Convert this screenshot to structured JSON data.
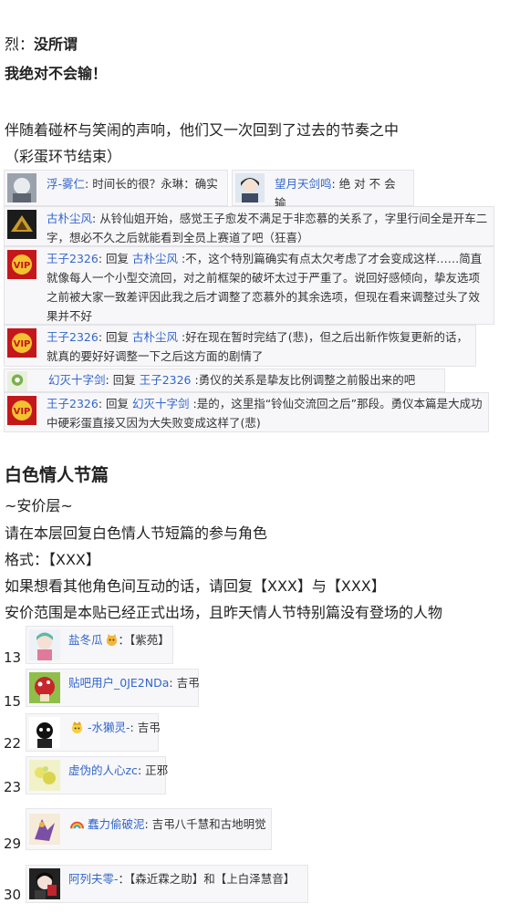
{
  "dialog": {
    "speaker_prefix": "烈：",
    "speaker_line": "没所谓",
    "shout": "我绝对不会输！"
  },
  "narration": "伴随着碰杯与笑闹的声响，他们又一次回到了过去的节奏之中",
  "egg_end": "（彩蛋环节结束）",
  "comments": [
    {
      "user": "浮-雾仁",
      "text": ": 时间长的很？永琳：确实"
    },
    {
      "user": "望月天剑鸣",
      "text": ": 绝 对 不 会 输"
    },
    {
      "user": "古朴尘风",
      "text": ": 从铃仙姐开始，感觉王子愈发不满足于非恋慕的关系了，字里行间全是开车二字，想必不久之后就能看到全员上赛道了吧（狂喜）"
    },
    {
      "user": "王子2326",
      "reply_word": "回复",
      "reply_to": "古朴尘风",
      "text": " :不，这个特別篇确实有点太欠考虑了才会变成这样……简直就像每人一个小型交流回，对之前框架的破坏太过于严重了。说回好感倾向，挚友选项之前被大家一致差评因此我之后才调整了恋慕外的其余选项，但现在看来调整过头了效果并不好"
    },
    {
      "user": "王子2326",
      "reply_word": "回复",
      "reply_to": "古朴尘风",
      "text": " :好在现在暂时完结了(悲)，但之后出新作恢复更新的话，就真的要好好调整一下之后这方面的剧情了"
    },
    {
      "user": "幻灭十字剑",
      "reply_word": "回复",
      "reply_to": "王子2326",
      "text": " :勇仪的关系是挚友比例调整之前骰出来的吧"
    },
    {
      "user": "王子2326",
      "reply_word": "回复",
      "reply_to": "幻灭十字剑",
      "text": " :是的，这里指“铃仙交流回之后”那段。勇仪本篇是大成功中硬彩蛋直接又因为大失败变成这样了(悲)"
    }
  ],
  "section": {
    "title": "白色情人节篇",
    "floor_note": "~安价层~",
    "instruction": "请在本层回复白色情人节短篇的参与角色",
    "format": "格式：【XXX】",
    "interaction": "如果想看其他角色间互动的话，请回复【XXX】与【XXX】",
    "range": "安价范围是本贴已经正式出场，且昨天情人节特别篇没有登场的人物"
  },
  "replies": [
    {
      "floor": "13",
      "user": "盐冬瓜",
      "badge": "cat-face-icon",
      "text": "：【紫苑】"
    },
    {
      "floor": "15",
      "user": "贴吧用户_0JE2NDa",
      "text": ": 吉弔"
    },
    {
      "floor": "22",
      "user": "-水獭灵-",
      "badge": "crown-face-icon",
      "text": ": 吉弔"
    },
    {
      "floor": "23",
      "user": "虚伪的人心zc",
      "text": ": 正邪"
    },
    {
      "floor": "29",
      "user": "蠢力偷破泥",
      "badge": "rainbow-icon",
      "text": ": 吉弔八千慧和古地明觉"
    },
    {
      "floor": "30",
      "user": "阿列夫零-",
      "text": "：【森近霖之助】和【上白泽慧音】"
    }
  ]
}
